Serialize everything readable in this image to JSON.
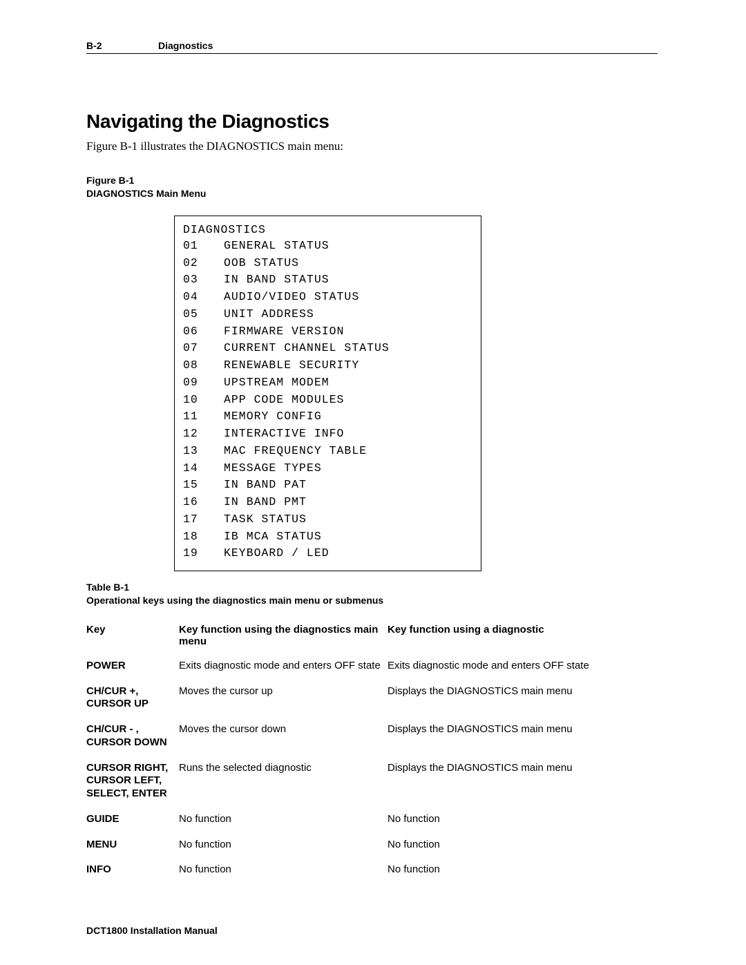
{
  "header": {
    "page": "B-2",
    "section": "Diagnostics"
  },
  "section_title": "Navigating the Diagnostics",
  "intro": "Figure B-1 illustrates the DIAGNOSTICS main menu:",
  "figure": {
    "id": "Figure B-1",
    "caption": "DIAGNOSTICS Main Menu"
  },
  "diagnostics": {
    "title": "DIAGNOSTICS",
    "items": [
      {
        "num": "01",
        "label": "GENERAL STATUS"
      },
      {
        "num": "02",
        "label": "OOB STATUS"
      },
      {
        "num": "03",
        "label": "IN BAND STATUS"
      },
      {
        "num": "04",
        "label": "AUDIO/VIDEO STATUS"
      },
      {
        "num": "05",
        "label": "UNIT ADDRESS"
      },
      {
        "num": "06",
        "label": "FIRMWARE VERSION"
      },
      {
        "num": "07",
        "label": "CURRENT CHANNEL STATUS"
      },
      {
        "num": "08",
        "label": "RENEWABLE SECURITY"
      },
      {
        "num": "09",
        "label": "UPSTREAM MODEM"
      },
      {
        "num": "10",
        "label": "APP CODE MODULES"
      },
      {
        "num": "11",
        "label": "MEMORY CONFIG"
      },
      {
        "num": "12",
        "label": "INTERACTIVE INFO"
      },
      {
        "num": "13",
        "label": "MAC FREQUENCY TABLE"
      },
      {
        "num": "14",
        "label": "MESSAGE TYPES"
      },
      {
        "num": "15",
        "label": "IN BAND PAT"
      },
      {
        "num": "16",
        "label": "IN BAND PMT"
      },
      {
        "num": "17",
        "label": "TASK STATUS"
      },
      {
        "num": "18",
        "label": "IB MCA STATUS"
      },
      {
        "num": "19",
        "label": "KEYBOARD / LED"
      }
    ]
  },
  "table": {
    "id": "Table B-1",
    "caption": "Operational keys using the diagnostics main menu or submenus",
    "headers": {
      "key": "Key",
      "main": "Key function using the diagnostics main menu",
      "diag": "Key function using a diagnostic"
    },
    "rows": [
      {
        "key": "POWER",
        "main": "Exits diagnostic mode and enters OFF state",
        "diag": "Exits diagnostic mode and enters OFF state"
      },
      {
        "key": "CH/CUR +, CURSOR UP",
        "main": "Moves the cursor up",
        "diag": "Displays the DIAGNOSTICS main menu"
      },
      {
        "key": "CH/CUR - , CURSOR DOWN",
        "main": "Moves the cursor down",
        "diag": "Displays the DIAGNOSTICS main menu"
      },
      {
        "key": "CURSOR RIGHT, CURSOR LEFT, SELECT, ENTER",
        "main": "Runs the selected diagnostic",
        "diag": "Displays the DIAGNOSTICS main menu"
      },
      {
        "key": "GUIDE",
        "main": "No function",
        "diag": "No function"
      },
      {
        "key": "MENU",
        "main": "No function",
        "diag": "No function"
      },
      {
        "key": "INFO",
        "main": "No function",
        "diag": "No function"
      }
    ]
  },
  "footer": "DCT1800 Installation Manual"
}
